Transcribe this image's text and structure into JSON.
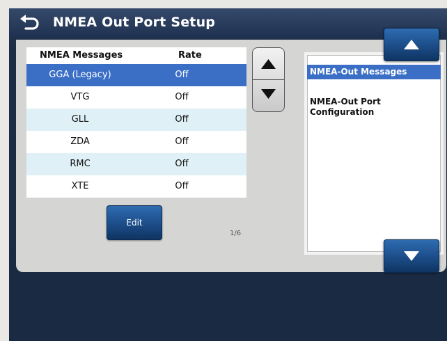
{
  "window": {
    "title": "NMEA Out Port Setup"
  },
  "table": {
    "headers": {
      "message": "NMEA Messages",
      "rate": "Rate"
    },
    "rows": [
      {
        "message": "GGA (Legacy)",
        "rate": "Off",
        "selected": true
      },
      {
        "message": "VTG",
        "rate": "Off"
      },
      {
        "message": "GLL",
        "rate": "Off"
      },
      {
        "message": "ZDA",
        "rate": "Off"
      },
      {
        "message": "RMC",
        "rate": "Off"
      },
      {
        "message": "XTE",
        "rate": "Off"
      }
    ],
    "page_indicator": "1/6"
  },
  "buttons": {
    "edit_label": "Edit"
  },
  "side_list": {
    "items": [
      {
        "label": "NMEA-Out Messages",
        "selected": true
      },
      {
        "label": "NMEA-Out Port Configuration"
      }
    ]
  },
  "icons": {
    "back": "back-arrow-icon",
    "up": "triangle-up-icon",
    "down": "triangle-down-icon"
  },
  "colors": {
    "selection": "#3b6fc6",
    "button": "#1f5290",
    "alt_row": "#dff0f6"
  }
}
